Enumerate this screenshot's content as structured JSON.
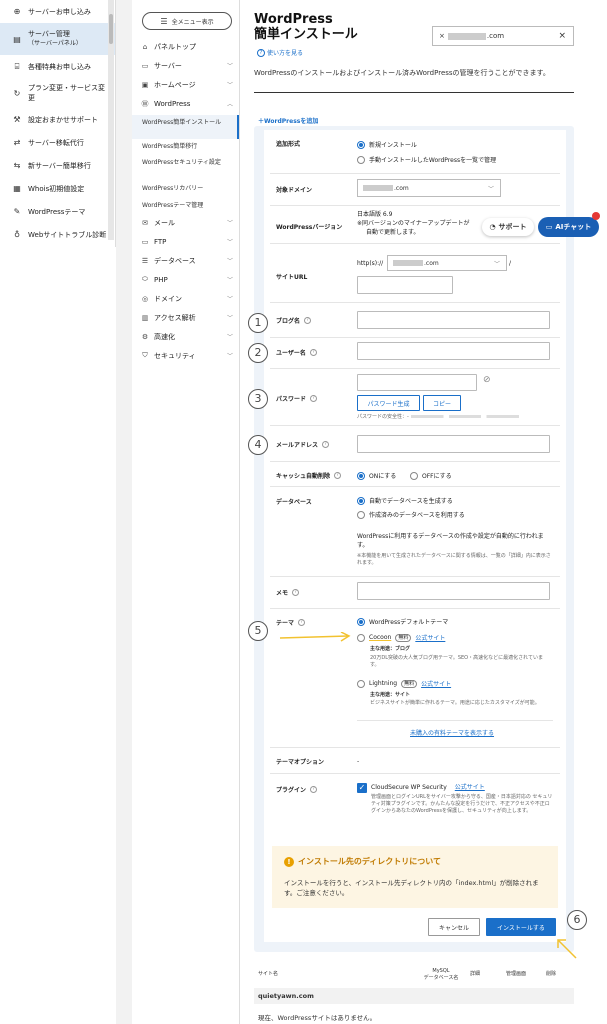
{
  "left_nav": [
    {
      "icon": "plus-circle-icon",
      "label": "サーバーお申し込み"
    },
    {
      "icon": "server-icon",
      "label": "サーバー管理",
      "sub": "（サーバーパネル）",
      "active": true
    },
    {
      "icon": "gift-icon",
      "label": "各種特典お申し込み"
    },
    {
      "icon": "refresh-icon",
      "label": "プラン変更・サービス変更"
    },
    {
      "icon": "wrench-icon",
      "label": "設定おまかせサポート"
    },
    {
      "icon": "transfer-icon",
      "label": "サーバー移転代行"
    },
    {
      "icon": "transfer-icon",
      "label": "新サーバー簡単移行"
    },
    {
      "icon": "document-icon",
      "label": "Whois初期値設定"
    },
    {
      "icon": "edit-icon",
      "label": "WordPressテーマ"
    },
    {
      "icon": "stethoscope-icon",
      "label": "Webサイトトラブル診断"
    }
  ],
  "sub_nav": {
    "all_menu": "全メニュー表示",
    "items": [
      {
        "icon": "home-icon",
        "label": "パネルトップ",
        "chev": ""
      },
      {
        "icon": "server-icon",
        "label": "サーバー",
        "chev": "﹀"
      },
      {
        "icon": "window-icon",
        "label": "ホームページ",
        "chev": "﹀"
      },
      {
        "icon": "wordpress-icon",
        "label": "WordPress",
        "chev": "︿"
      }
    ],
    "wp_subs": [
      "WordPress簡単インストール",
      "WordPress簡単移行",
      "WordPressセキュリティ設定",
      "WordPressリカバリー",
      "WordPressテーマ管理"
    ],
    "items2": [
      {
        "icon": "mail-icon",
        "label": "メール"
      },
      {
        "icon": "ftp-icon",
        "label": "FTP"
      },
      {
        "icon": "database-icon",
        "label": "データベース"
      },
      {
        "icon": "php-icon",
        "label": "PHP"
      },
      {
        "icon": "globe-icon",
        "label": "ドメイン"
      },
      {
        "icon": "chart-icon",
        "label": "アクセス解析"
      },
      {
        "icon": "speed-icon",
        "label": "高速化"
      },
      {
        "icon": "shield-icon",
        "label": "セキュリティ"
      }
    ]
  },
  "header": {
    "title_line1": "WordPress",
    "title_line2": "簡単インストール",
    "howto": "使い方を見る",
    "domain_prefix": "×",
    "domain_suffix": ".com",
    "close": "×",
    "description": "WordPressのインストールおよびインストール済みWordPressの管理を行うことができます。"
  },
  "form": {
    "add_link": "＋WordPressを追加",
    "labels": {
      "add_type": "追加形式",
      "domain": "対象ドメイン",
      "wp_version": "WordPressバージョン",
      "site_url": "サイトURL",
      "blog_name": "ブログ名",
      "user_name": "ユーザー名",
      "password": "パスワード",
      "email": "メールアドレス",
      "cache": "キャッシュ自動削除",
      "database": "データベース",
      "memo": "メモ",
      "theme": "テーマ",
      "theme_option": "テーマオプション",
      "plugin": "プラグイン"
    },
    "add_type_options": [
      "新規インストール",
      "手動インストールしたWordPressを一覧で管理"
    ],
    "domain_suffix": ".com",
    "wp_version_value": "日本語版 6.9",
    "wp_version_note1": "※同バージョンのマイナーアップデートが",
    "wp_version_note2": "自動で更新します。",
    "url_prefix": "http(s)://",
    "url_suffix": ".com",
    "url_slash": "/",
    "pw_generate": "パスワード生成",
    "pw_copy": "コピー",
    "pw_strength": "パスワードの安全性：-",
    "cache_on": "ONにする",
    "cache_off": "OFFにする",
    "db_options": [
      "自動でデータベースを生成する",
      "作成済みのデータベースを利用する"
    ],
    "db_note1": "WordPressに利用するデータベースの作成や設定が自動的に行われます。",
    "db_note2": "※本機能を用いて生成されたデータベースに関する情報は、一覧の「詳細」内に表示されます。",
    "theme_default": "WordPressデフォルトテーマ",
    "theme_cocoon": "Cocoon",
    "theme_free": "無料",
    "theme_official": "公式サイト",
    "cocoon_use": "主な用途：ブログ",
    "cocoon_desc": "20万DL突破の大人気ブログ用テーマ。SEO・高速化などに最適化されています。",
    "theme_lightning": "Lightning",
    "lightning_use": "主な用途：サイト",
    "lightning_desc": "ビジネスサイトが簡単に作れるテーマ。用途に応じたカスタマイズが可能。",
    "more_themes": "未購入の有料テーマを表示する",
    "theme_option_value": "-",
    "plugin_name": "CloudSecure WP Security",
    "plugin_official": "公式サイト",
    "plugin_desc": "管理画面とログインURLをサイバー攻撃から守る、国産・日本語対応の セキュリティ対策プラグインです。かんたんな設定を行うだけで、不正アクセスや不正ログインからあなたのWordPressを保護し、セキュリティが向上します。",
    "notice_title": "インストール先のディレクトリについて",
    "notice_body": "インストールを行うと、インストール先ディレクトリ内の「index.html」が削除されます。ご注意ください。",
    "cancel": "キャンセル",
    "install": "インストールする"
  },
  "floating": {
    "support": "サポート",
    "ai_chat": "AIチャット"
  },
  "steps": [
    "1",
    "2",
    "3",
    "4",
    "5",
    "6"
  ],
  "table": {
    "headers": [
      "サイト名",
      "MySQL\nデータベース名",
      "詳細",
      "管理画面",
      "削除"
    ],
    "domain_row": "quietyawn.com",
    "empty": "現在、WordPressサイトはありません。"
  },
  "colors": {
    "accent": "#1a6fc9",
    "annotation_arrow": "#f2c230",
    "ai_chat": "#1a5fb4",
    "notice_bg": "#fdf5e3"
  }
}
